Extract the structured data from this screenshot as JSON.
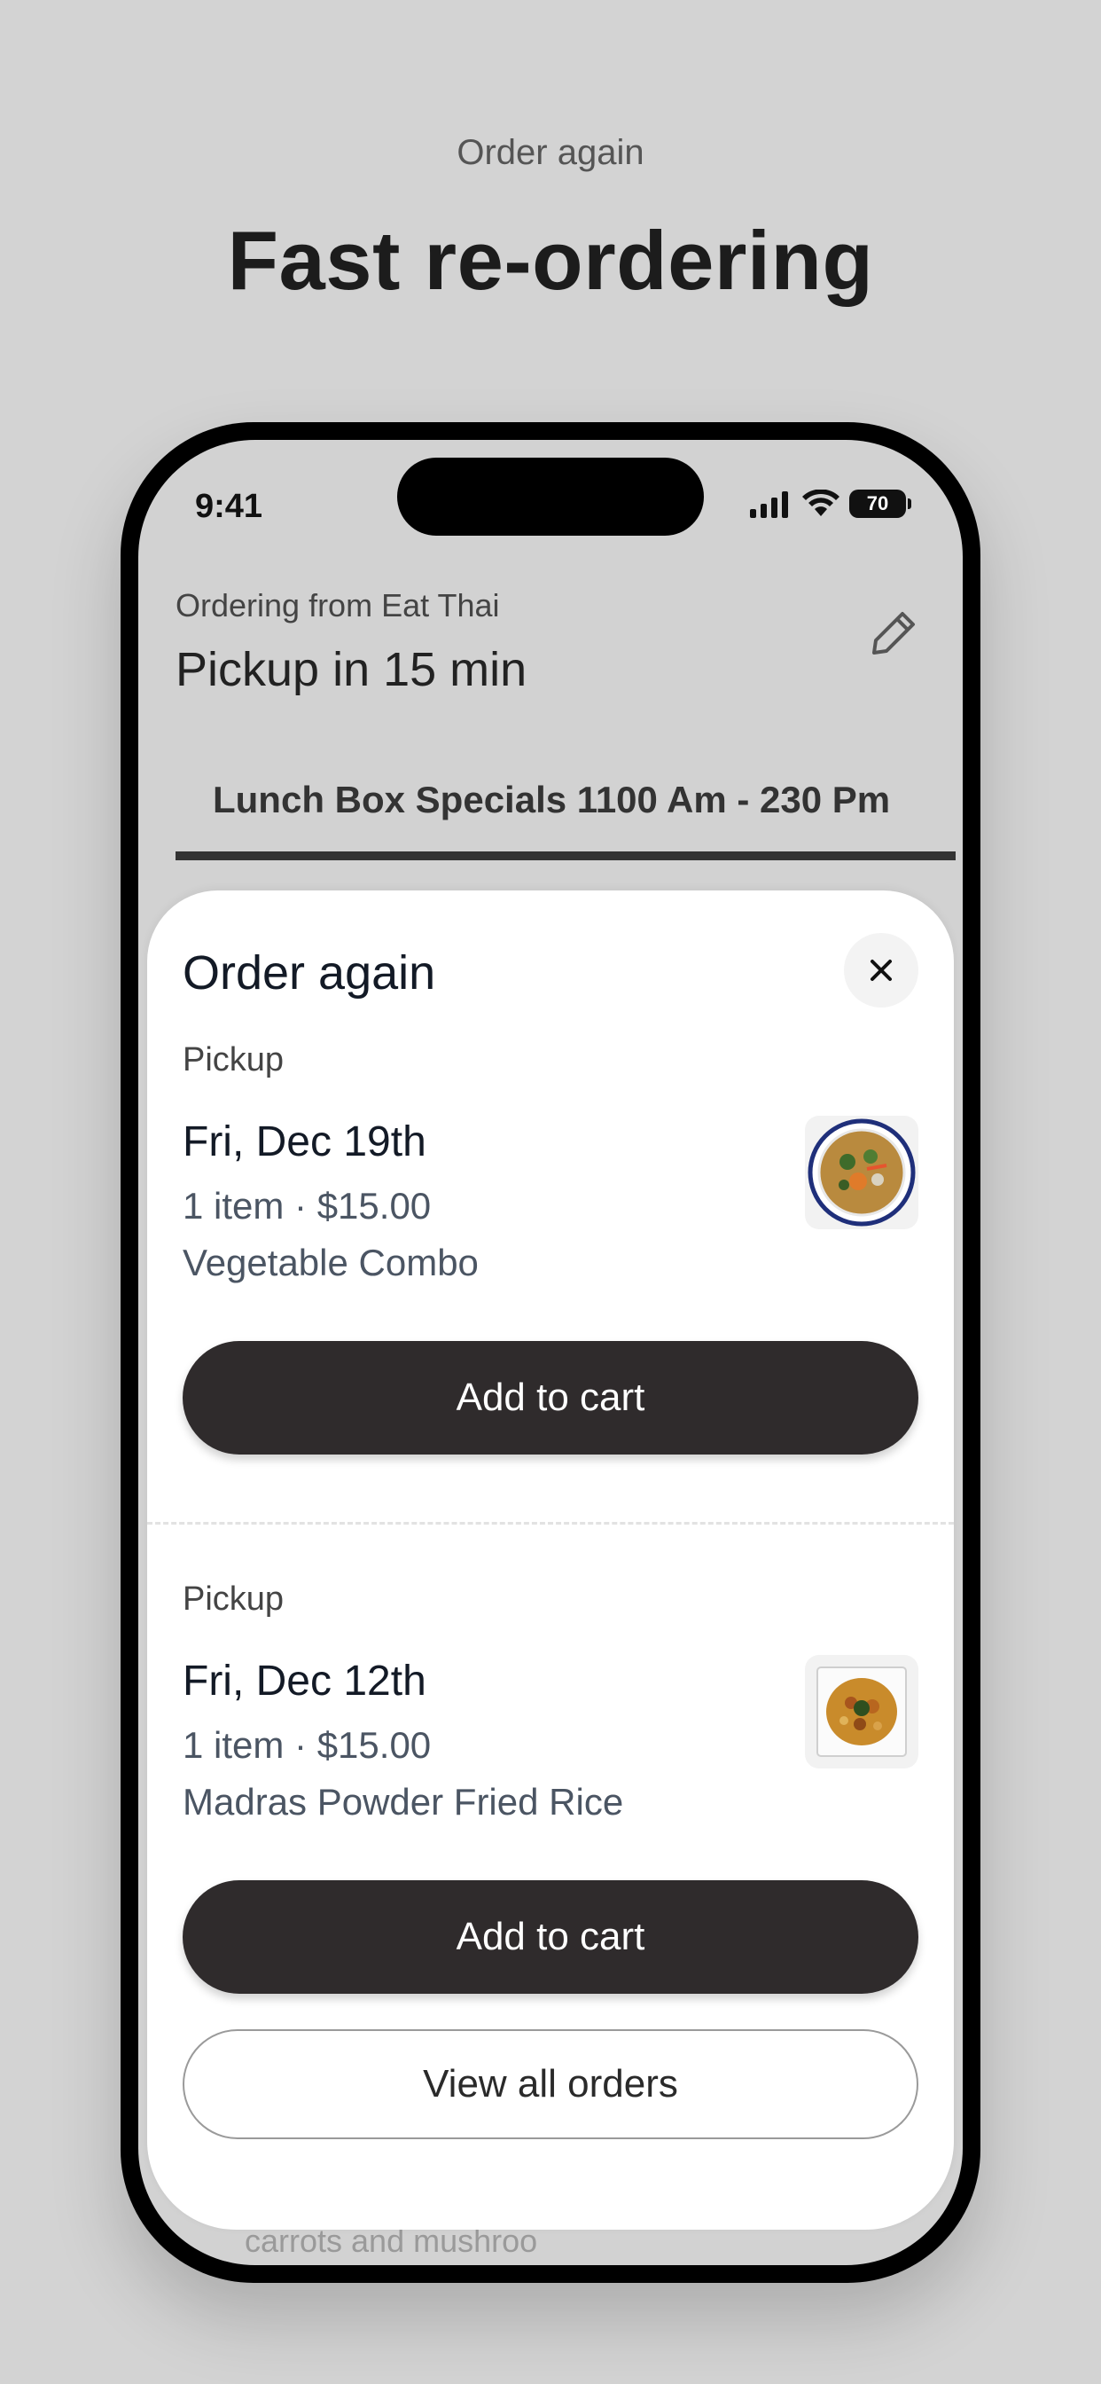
{
  "marketing": {
    "eyebrow": "Order again",
    "title": "Fast re-ordering"
  },
  "status_bar": {
    "time": "9:41",
    "battery": "70"
  },
  "header": {
    "ordering_from": "Ordering from Eat Thai",
    "pickup_eta": "Pickup in 15 min",
    "edit_icon": "pencil-icon"
  },
  "menu_tab": {
    "label": "Lunch Box Specials 1100 Am - 230 Pm"
  },
  "background_peek": "carrots and mushroo",
  "sheet": {
    "title": "Order again",
    "close_icon": "close-icon",
    "orders": [
      {
        "type": "Pickup",
        "date": "Fri, Dec 19th",
        "meta": "1 item · $15.00",
        "item": "Vegetable Combo",
        "button": "Add to cart",
        "thumb_icon": "vegetable-curry-bowl-image"
      },
      {
        "type": "Pickup",
        "date": "Fri, Dec 12th",
        "meta": "1 item · $15.00",
        "item": "Madras Powder Fried Rice",
        "button": "Add to cart",
        "thumb_icon": "fried-rice-plate-image"
      }
    ],
    "view_all": "View all orders"
  },
  "colors": {
    "background": "#d3d3d3",
    "button_dark": "#2f2b2c",
    "sheet": "#ffffff",
    "text_primary": "#131a26",
    "text_secondary": "#4b5563"
  }
}
